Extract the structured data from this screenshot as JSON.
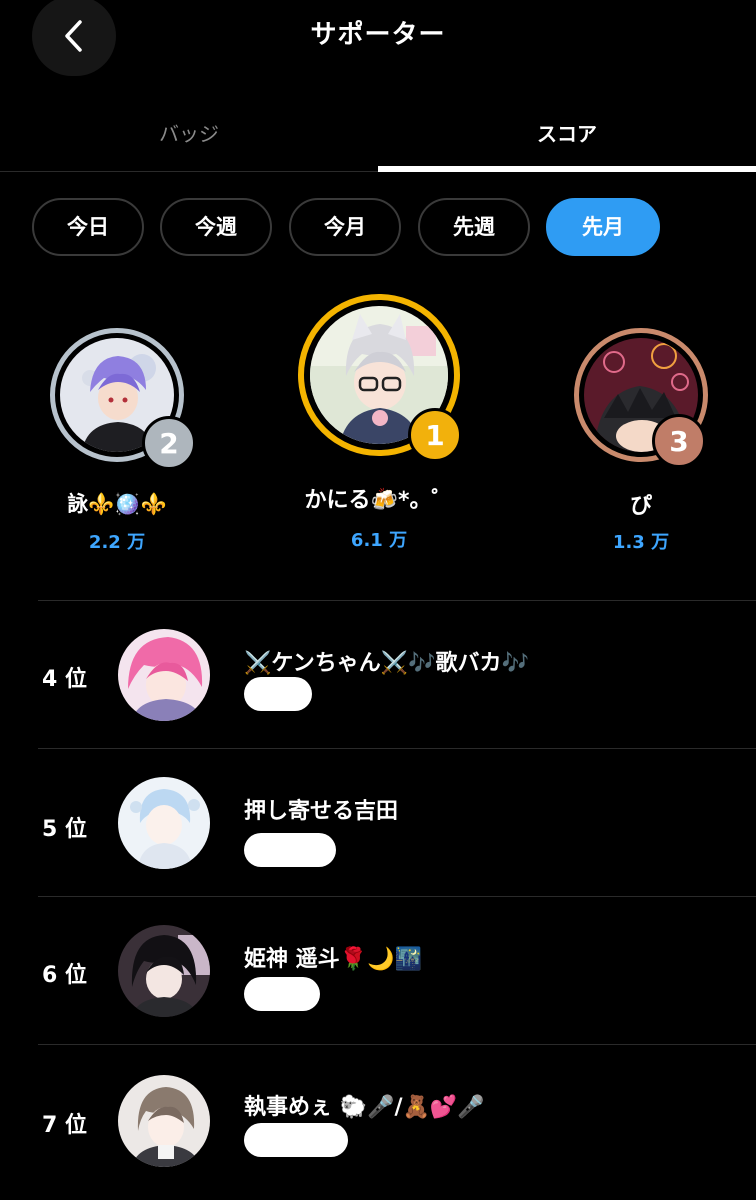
{
  "header": {
    "title": "サポーター",
    "back_icon": "chevron-left-icon"
  },
  "tabs": [
    {
      "label": "バッジ"
    },
    {
      "label": "スコア"
    }
  ],
  "periods": [
    {
      "label": "今日"
    },
    {
      "label": "今週"
    },
    {
      "label": "今月"
    },
    {
      "label": "先週"
    },
    {
      "label": "先月"
    }
  ],
  "active_period": "先月",
  "podium": [
    {
      "rank": "2",
      "name": "詠⚜️🪩⚜️",
      "score": "2.2 万",
      "ring_color": "#b7c2cc",
      "badge_color": "#aeb6bd"
    },
    {
      "rank": "1",
      "name": "かにる🍻*。゜",
      "score": "6.1 万",
      "ring_color": "#f4b400",
      "badge_color": "#f2b10c"
    },
    {
      "rank": "3",
      "name": "ぴ",
      "score": "1.3 万",
      "ring_color": "#c98a6c",
      "badge_color": "#c07d68"
    }
  ],
  "list": [
    {
      "rank": "4 位",
      "name": "⚔️ケンちゃん⚔️🎶歌バカ🎶"
    },
    {
      "rank": "5 位",
      "name": "押し寄せる吉田"
    },
    {
      "rank": "6 位",
      "name": "姫神 遥斗🌹🌙🌃"
    },
    {
      "rank": "7 位",
      "name": "執事めぇ 🐑🎤/🧸💕🎤"
    }
  ],
  "colors": {
    "accent": "#2f9cf3",
    "score_blue": "#3ea6ff",
    "background": "#000000"
  }
}
